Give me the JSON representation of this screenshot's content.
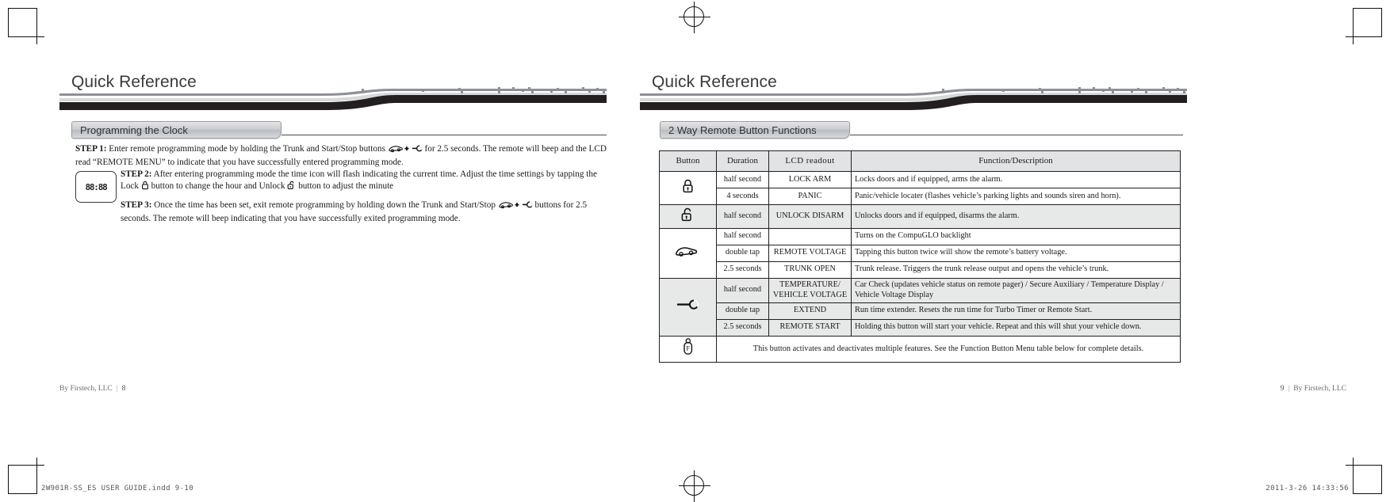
{
  "spread": {
    "left_page": {
      "header_title": "Quick Reference",
      "section_tab": "Programming the Clock",
      "lcd_mock_segments": "88:88",
      "steps": {
        "step1_label": "STEP 1:",
        "step1_text_a": "Enter remote programming mode by holding the Trunk and Start/Stop buttons",
        "step1_text_b": "for 2.5 seconds. The remote will beep and the LCD read “REMOTE MENU” to indicate that you have successfully entered programming mode.",
        "step2_label": "STEP 2:",
        "step2_text_a": "After entering programming mode the time icon will flash indicating the current time. Adjust the time settings by tapping the Lock",
        "step2_text_b": "button to change the hour and Unlock",
        "step2_text_c": "button to adjust the minute",
        "step3_label": "STEP 3:",
        "step3_text_a": "Once the time has been set, exit remote programming by holding down the Trunk and Start/Stop",
        "step3_text_b": "buttons for 2.5 seconds. The remote will beep indicating that you have successfully exited programming mode."
      },
      "footer_credit": "By Firstech, LLC",
      "footer_page": "8"
    },
    "right_page": {
      "header_title": "Quick Reference",
      "section_tab": "2 Way Remote Button Functions",
      "footer_credit": "By Firstech, LLC",
      "footer_page": "9",
      "table": {
        "headers": [
          "Button",
          "Duration",
          "LCD  readout",
          "Function/Description"
        ],
        "rows": [
          {
            "button_icon": "lock-icon",
            "duration": "half second",
            "lcd": "LOCK ARM",
            "fn": "Locks doors and if equipped, arms the alarm.",
            "shaded": false
          },
          {
            "button_icon": "",
            "duration": "4 seconds",
            "lcd": "PANIC",
            "fn": "Panic/vehicle locater (flashes vehicle’s parking lights and sounds siren and horn).",
            "shaded": false
          },
          {
            "button_icon": "unlock-icon",
            "duration": "half second",
            "lcd": "UNLOCK DISARM",
            "fn": "Unlocks doors and if equipped, disarms the alarm.",
            "shaded": true
          },
          {
            "button_icon": "",
            "duration": "half second",
            "lcd": "",
            "fn": "Turns on the CompuGLO backlight",
            "shaded": false
          },
          {
            "button_icon": "trunk-car-icon",
            "duration": "double tap",
            "lcd": "REMOTE VOLTAGE",
            "fn": "Tapping this button twice will show the remote’s battery voltage.",
            "shaded": false
          },
          {
            "button_icon": "",
            "duration": "2.5 seconds",
            "lcd": "TRUNK OPEN",
            "fn": "Trunk release. Triggers the trunk release output and opens the vehicle’s trunk.",
            "shaded": false
          },
          {
            "button_icon": "",
            "duration": "half second",
            "lcd": "TEMPERATURE/\nVEHICLE VOLTAGE",
            "fn": "Car Check (updates vehicle status on remote pager) /  Secure Auxiliary / Temperature Display / Vehicle Voltage Display",
            "shaded": true
          },
          {
            "button_icon": "key-start-icon",
            "duration": "double tap",
            "lcd": "EXTEND",
            "fn": "Run time extender. Resets the run time for Turbo Timer or Remote Start.",
            "shaded": true
          },
          {
            "button_icon": "",
            "duration": "2.5 seconds",
            "lcd": "REMOTE START",
            "fn": "Holding this button will start your vehicle. Repeat and this will shut your vehicle down.",
            "shaded": true
          }
        ],
        "final_row": {
          "button_icon": "function-button-icon",
          "text": "This button activates and deactivates multiple features. See the Function Button Menu table below for complete details."
        }
      }
    }
  },
  "print_marks": {
    "file_name": "2W901R-SS_ES USER GUIDE.indd   9-10",
    "timestamp": "2011-3-26    14:33:56"
  },
  "colors": {
    "banner_dark": "#231f20",
    "banner_gray": "#8d9196",
    "tab_gray": "#c9cbce",
    "table_shade": "#e7e8e8",
    "table_header": "#e2e3e4",
    "rule": "#4a4a4a"
  }
}
